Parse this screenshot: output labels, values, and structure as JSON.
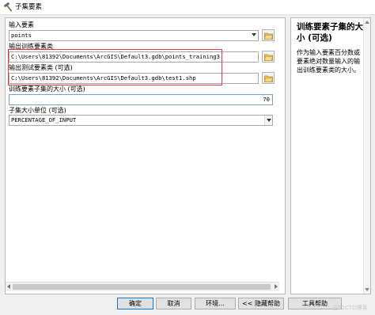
{
  "window": {
    "title": "子集要素",
    "icon": "hammer-icon"
  },
  "form": {
    "input_features": {
      "label": "输入要素",
      "value": "points"
    },
    "output_training": {
      "label": "输出训练要素类",
      "value": "C:\\Users\\81392\\Documents\\ArcGIS\\Default3.gdb\\points_training3"
    },
    "output_test": {
      "label": "输出测试要素类 (可选)",
      "value": "C:\\Users\\81392\\Documents\\ArcGIS\\Default3.gdb\\test1.shp"
    },
    "subset_size": {
      "label": "训练要素子集的大小 (可选)",
      "value": "70"
    },
    "size_units": {
      "label": "子集大小单位 (可选)",
      "value": "PERCENTAGE_OF_INPUT"
    },
    "highlight_color": "#e23b3b"
  },
  "help": {
    "title": "训练要素子集的大小 (可选)",
    "body": "作为输入要素百分数或要素绝对数量输入的输出训练要素类的大小。"
  },
  "buttons": {
    "ok": "确定",
    "cancel": "取消",
    "environments": "环境...",
    "hide_help": "<< 隐藏帮助",
    "tool_help": "工具帮助"
  },
  "watermark": "@51CTO博客"
}
